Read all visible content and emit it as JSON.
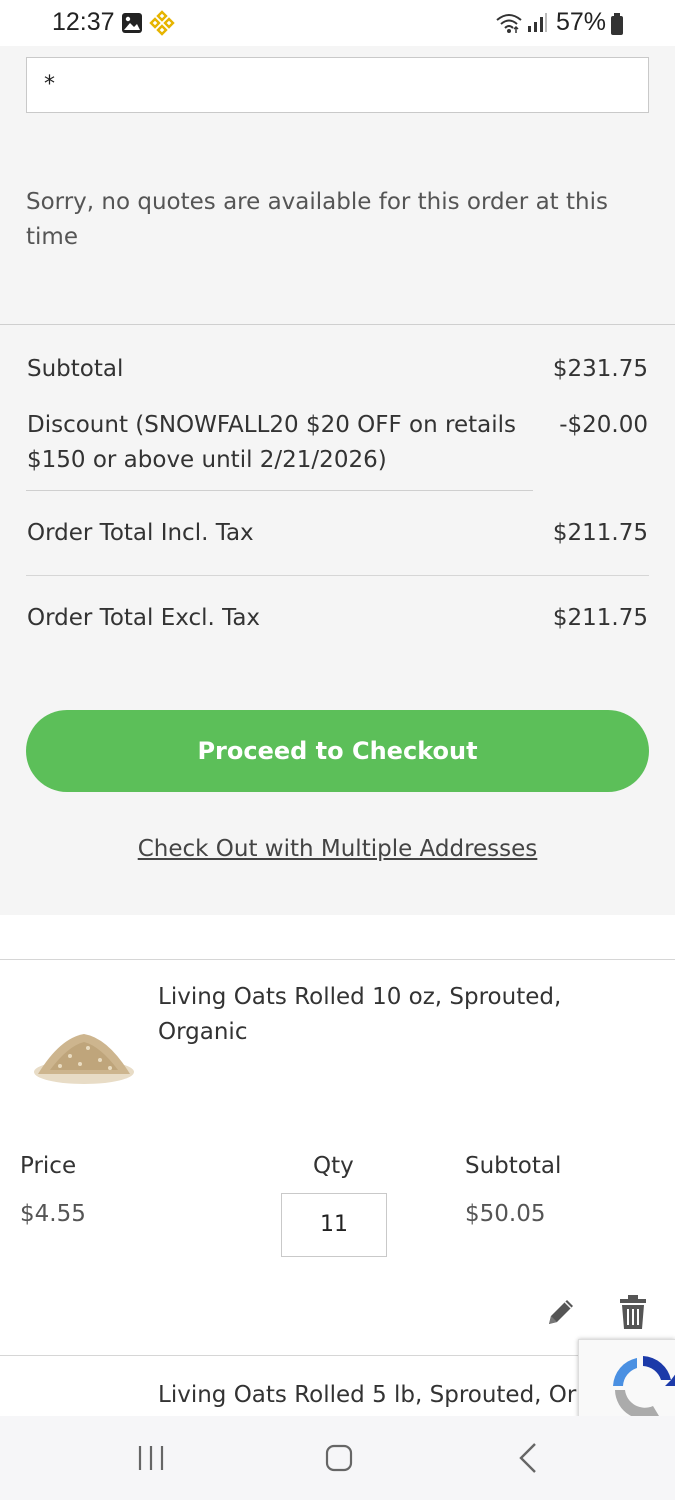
{
  "status_bar": {
    "time": "12:37",
    "battery": "57%"
  },
  "summary": {
    "code_input_value": "*",
    "no_quotes_message": "Sorry, no quotes are available for this order at this time",
    "subtotal_label": "Subtotal",
    "subtotal_value": "$231.75",
    "discount_label": "Discount (SNOWFALL20 $20 OFF on retails $150 or above until 2/21/2026)",
    "discount_value": "-$20.00",
    "total_incl_label": "Order Total Incl. Tax",
    "total_incl_value": "$211.75",
    "total_excl_label": "Order Total Excl. Tax",
    "total_excl_value": "$211.75",
    "checkout_button": "Proceed to Checkout",
    "multi_address_link": "Check Out with Multiple Addresses"
  },
  "cart": {
    "items": [
      {
        "name": "Living Oats Rolled 10 oz, Sprouted, Organic",
        "price_label": "Price",
        "price": "$4.55",
        "qty_label": "Qty",
        "qty": "11",
        "subtotal_label": "Subtotal",
        "subtotal": "$50.05"
      },
      {
        "name": "Living Oats Rolled 5 lb, Sprouted, Or"
      }
    ]
  },
  "colors": {
    "checkout_green": "#5cbf59",
    "summary_bg": "#f5f5f5"
  },
  "icons": {
    "edit": "pencil-icon",
    "delete": "trash-icon",
    "recaptcha": "recaptcha-icon"
  }
}
